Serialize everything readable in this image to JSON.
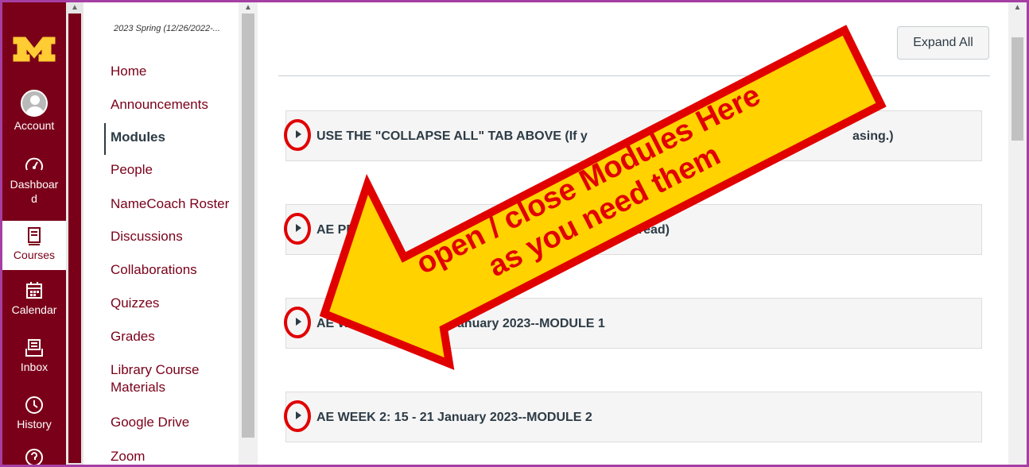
{
  "global_nav": {
    "items": [
      {
        "label": "Account",
        "icon": "avatar"
      },
      {
        "label": "Dashboar\nd",
        "icon": "dashboard-icon"
      },
      {
        "label": "Courses",
        "icon": "courses-icon",
        "active": true
      },
      {
        "label": "Calendar",
        "icon": "calendar-icon"
      },
      {
        "label": "Inbox",
        "icon": "inbox-icon"
      },
      {
        "label": "History",
        "icon": "history-icon"
      }
    ],
    "colors": {
      "brand": "#7a0019",
      "gold": "#ffcc33"
    }
  },
  "course_nav": {
    "term": "2023 Spring (12/26/2022-...",
    "items": [
      {
        "label": "Home"
      },
      {
        "label": "Announcements"
      },
      {
        "label": "Modules",
        "active": true
      },
      {
        "label": "People"
      },
      {
        "label": "NameCoach Roster"
      },
      {
        "label": "Discussions"
      },
      {
        "label": "Collaborations"
      },
      {
        "label": "Quizzes"
      },
      {
        "label": "Grades"
      },
      {
        "label": "Library Course\nMaterials"
      },
      {
        "label": "Google Drive"
      },
      {
        "label": "Zoom"
      }
    ]
  },
  "main": {
    "expand_all_label": "Expand All",
    "modules": [
      {
        "title": "USE THE \"COLLAPSE ALL\" TAB ABOVE (If y",
        "title_tail": "asing.)"
      },
      {
        "title": "AE PR",
        "title_tail": "E, but read)"
      },
      {
        "title": "AE W",
        "title_tail": "January 2023--MODULE 1"
      },
      {
        "title": "AE WEEK 2: 15 - 21 January 2023--MODULE 2",
        "title_tail": ""
      }
    ]
  },
  "annotation": {
    "callout_line1": "open / close Modules Here",
    "callout_line2": "as you need them",
    "arrow_fill": "#ffd200",
    "arrow_stroke": "#e10000"
  }
}
